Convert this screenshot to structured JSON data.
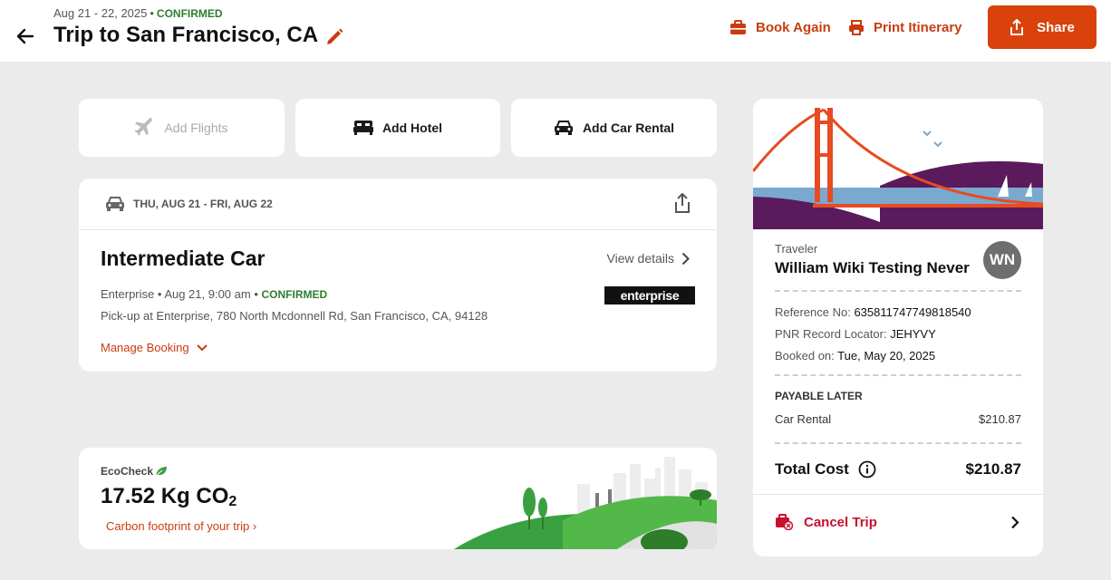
{
  "header": {
    "dates": "Aug 21 - 22, 2025",
    "status": "CONFIRMED",
    "title": "Trip to San Francisco, CA",
    "book_again": "Book Again",
    "print_itinerary": "Print Itinerary",
    "share": "Share"
  },
  "add_buttons": {
    "flights": "Add Flights",
    "hotel": "Add Hotel",
    "car": "Add Car Rental"
  },
  "car": {
    "dates": "THU, AUG 21 - FRI, AUG 22",
    "name": "Intermediate Car",
    "view_details": "View details",
    "vendor": "Enterprise",
    "pickup_time": "Aug 21, 9:00 am",
    "status": "CONFIRMED",
    "pickup_address": "Pick-up at Enterprise, 780 North Mcdonnell Rd, San Francisco, CA, 94128",
    "manage": "Manage Booking",
    "logo_text": "enterprise"
  },
  "eco": {
    "label": "EcoCheck",
    "value": "17.52 Kg CO",
    "subscript": "2",
    "link": "Carbon footprint of your trip ›"
  },
  "summary": {
    "traveler_label": "Traveler",
    "traveler_name": "William Wiki Testing Never",
    "avatar_initials": "WN",
    "reference_label": "Reference No:",
    "reference_value": "635811747749818540",
    "pnr_label": "PNR Record Locator:",
    "pnr_value": "JEHYVY",
    "booked_label": "Booked on:",
    "booked_value": "Tue, May 20, 2025",
    "payable_later": "PAYABLE LATER",
    "line_item_label": "Car Rental",
    "line_item_value": "$210.87",
    "total_label": "Total Cost",
    "total_value": "$210.87",
    "cancel": "Cancel Trip"
  },
  "colors": {
    "accent": "#d9420b",
    "link": "#c83c10",
    "confirmed": "#2e7d32",
    "cancel": "#c8102e"
  }
}
